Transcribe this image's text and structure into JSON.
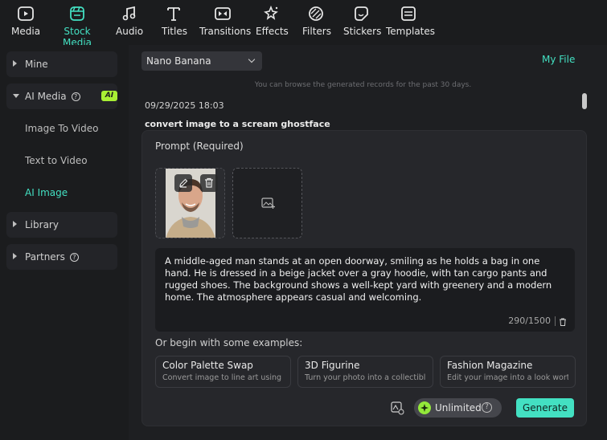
{
  "toolbar": {
    "items": [
      {
        "label": "Media",
        "icon": "media-icon"
      },
      {
        "label": "Stock Media",
        "icon": "stock-media-icon",
        "active": true
      },
      {
        "label": "Audio",
        "icon": "music-note-icon"
      },
      {
        "label": "Titles",
        "icon": "titles-icon"
      },
      {
        "label": "Transitions",
        "icon": "transitions-icon"
      },
      {
        "label": "Effects",
        "icon": "effects-icon"
      },
      {
        "label": "Filters",
        "icon": "filters-icon"
      },
      {
        "label": "Stickers",
        "icon": "stickers-icon"
      },
      {
        "label": "Templates",
        "icon": "templates-icon"
      }
    ]
  },
  "sidebar": {
    "mine": "Mine",
    "ai_media": "AI Media",
    "ai_badge": "AI",
    "sub_items": [
      "Image To Video",
      "Text to Video",
      "AI Image"
    ],
    "library": "Library",
    "partners": "Partners",
    "help_glyph": "?"
  },
  "main": {
    "model": "Nano Banana",
    "my_file": "My File",
    "hint": "You can browse the generated records for the past 30 days.",
    "date": "09/29/2025 18:03",
    "task": "convert image to a scream ghostface",
    "prompt_label": "Prompt (Required)",
    "prompt_text": "A middle-aged man stands at an open doorway, smiling as he holds a bag in one hand. He is dressed in a beige jacket over a gray hoodie, with tan cargo pants and rugged shoes. The background shows a well-kept yard with greenery and a modern home. The atmosphere appears casual and welcoming.",
    "counter": "290/1500",
    "examples_label": "Or begin with some examples:",
    "examples": [
      {
        "title": "Color Palette Swap",
        "desc": "Convert image to line art using a..."
      },
      {
        "title": "3D Figurine",
        "desc": "Turn your photo into a collectibl..."
      },
      {
        "title": "Fashion Magazine",
        "desc": "Edit your image into a look wort..."
      }
    ],
    "unlimited": "Unlimited",
    "generate": "Generate"
  },
  "colors": {
    "accent": "#43e0c2",
    "ai_badge": "#a8ef34",
    "gem": "#93e83a"
  }
}
